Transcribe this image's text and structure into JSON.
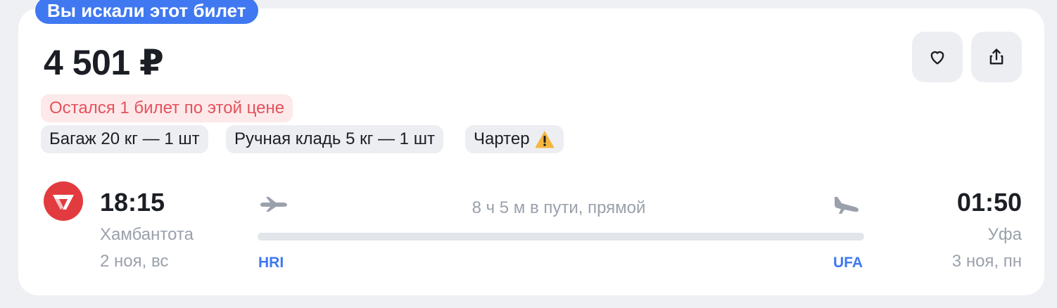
{
  "badge": {
    "label": "Вы искали этот билет"
  },
  "ticket": {
    "price": "4 501 ₽",
    "seats_warning": "Остался 1 билет по этой цене",
    "tags": {
      "baggage": "Багаж 20 кг — 1 шт",
      "hand_luggage": "Ручная кладь 5 кг — 1 шт",
      "charter": "Чартер"
    },
    "airline_logo_icon": "airline-logo-icon",
    "departure": {
      "time": "18:15",
      "city": "Хамбантота",
      "date": "2 ноя, вс",
      "code": "HRI"
    },
    "arrival": {
      "time": "01:50",
      "city": "Уфа",
      "date": "3 ноя, пн",
      "code": "UFA"
    },
    "duration": "8 ч 5 м в пути, прямой"
  },
  "actions": {
    "favorite_icon": "heart-icon",
    "share_icon": "share-icon"
  },
  "colors": {
    "accent": "#3f78f0",
    "warning_text": "#e5515c",
    "warning_bg": "#fde9ea",
    "airline_red": "#e23b3f",
    "charter_warning": "#f4b63f"
  }
}
